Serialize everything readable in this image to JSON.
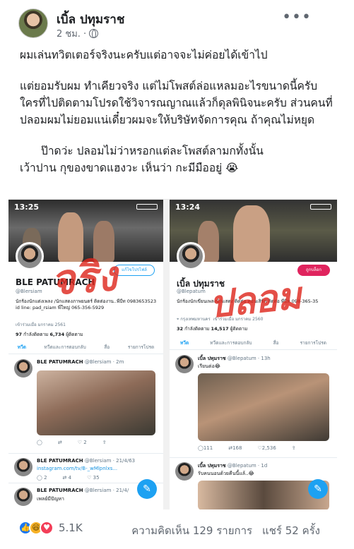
{
  "post": {
    "author": "เบิ้ล ปทุมราช",
    "time": "2 ชม. ·",
    "more": "•••",
    "paragraphs": [
      "ผมเล่นทวิตเตอร์จริงนะครับแต่อาจจะไม่ค่อยได้เข้าไป",
      "แต่ยอมรับผม ทำเคียวจริง แต่ไม่โพสต์ล่อแหลมอะไรขนาดนี้ครับ ใครที่ไปติดตามโปรดใช้วิจารณญาณแล้วก็ดุลพินิจนะครับ ส่วนคนที่ปลอมผมไม่ยอมแน่เดี๋ยวผมจะให้บริษัทจัดการคุณ ถ้าคุณไม่หยุด",
      "ป๊าดว่ะ ปลอมไม่ว่าหรอกแต่ละโพสต์ลามกทั้งนั้น",
      "เว้าปาน กุของขาดแฮงวะ เห็นว่า กะมีมืออยู่ 😭"
    ]
  },
  "screenshot": {
    "left": {
      "time": "13:25",
      "edit_label": "แก้ไขโปรไฟล์",
      "name": "BLE PATUMRACH",
      "handle": "@Blersiam",
      "bio": "นักร้องนักแต่งเพลง /นักแสดงภาพยนตร์ ติดต่องาน..พีบีท 0983653523 id line: pad_rsiam พี่ใหญ่ 065-356-5929",
      "joined": "เข้าร่วมเมื่อ มกราคม 2561",
      "following": "97",
      "following_label": "กำลังติดตาม",
      "followers": "6,734",
      "followers_label": "ผู้ติดตาม",
      "tabs": [
        "ทวีต",
        "ทวีตและการตอบกลับ",
        "สื่อ",
        "รายการโปรด"
      ],
      "tweets": [
        {
          "name": "BLE PATUMRACH",
          "meta": "@Blersiam · 2m",
          "body": "",
          "actions": [
            "",
            "",
            "2",
            ""
          ]
        },
        {
          "name": "BLE PATUMRACH",
          "meta": "@Blersiam · 21/4/63",
          "body": "instagram.com/tv/B-_wMlpnlxs...",
          "actions": [
            "2",
            "4",
            "35",
            ""
          ]
        },
        {
          "name": "BLE PATUMRACH",
          "meta": "@Blersiam · 21/4/",
          "body": "เพลย์มีปัญหา",
          "actions": []
        }
      ],
      "handwriting": "จริง"
    },
    "right": {
      "time": "13:24",
      "follow_label": "ถูกบล็อก",
      "name": "เบิ้ล ปทุมราช",
      "handle": "@Blepatum",
      "bio": "นักร้องนักเขียนเพลงนักแสดง ติดต่อ คอนเสิร์ต ติดต่อ พีบีท 098-365-35",
      "location": "กรุงเทพมหานคร",
      "joined": "เข้าร่วมเมื่อ มกราคม 2560",
      "following": "32",
      "following_label": "กำลังติดตาม",
      "followers": "14,517",
      "followers_label": "ผู้ติดตาม",
      "tabs": [
        "ทวีต",
        "ทวีตและการตอบกลับ",
        "สื่อ",
        "รายการโปรด"
      ],
      "tweets": [
        {
          "name": "เบิ้ล ปทุมราช",
          "meta": "@Blepatum · 13h",
          "body": "เรียนต่อ😂",
          "actions": [
            "111",
            "168",
            "2,536",
            ""
          ]
        },
        {
          "name": "เบิ้ล ปทุมราช",
          "meta": "@Blepatum · 1d",
          "body": "รับคนนอนด้วยคืนนี้แล้..😂",
          "actions": []
        }
      ],
      "handwriting": "ปลอม"
    }
  },
  "footer": {
    "reaction_count": "5.1K",
    "comments": "ความคิดเห็น 129 รายการ",
    "shares": "แชร์ 52 ครั้ง"
  }
}
